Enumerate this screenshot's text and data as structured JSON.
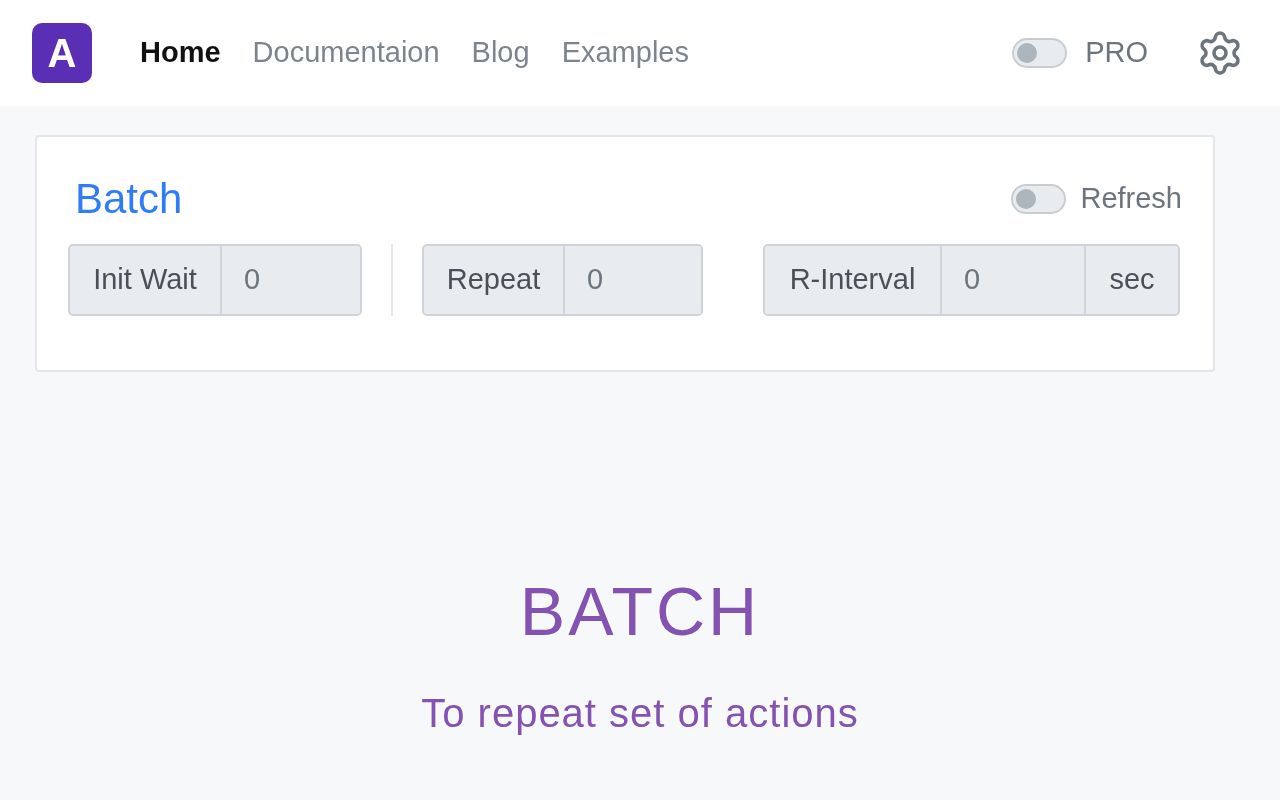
{
  "header": {
    "logo": "A",
    "nav": [
      {
        "label": "Home",
        "selected": true
      },
      {
        "label": "Documentaion",
        "selected": false
      },
      {
        "label": "Blog",
        "selected": false
      },
      {
        "label": "Examples",
        "selected": false
      }
    ],
    "pro_toggle": {
      "label": "PRO",
      "on": false
    }
  },
  "card": {
    "title": "Batch",
    "refresh_toggle": {
      "label": "Refresh",
      "on": false
    },
    "fields": [
      {
        "label": "Init Wait",
        "value": "0"
      },
      {
        "label": "Repeat",
        "value": "0"
      },
      {
        "label": "R-Interval",
        "value": "0",
        "suffix": "sec"
      }
    ]
  },
  "hero": {
    "title": "BATCH",
    "subtitle": "To repeat set of actions"
  }
}
